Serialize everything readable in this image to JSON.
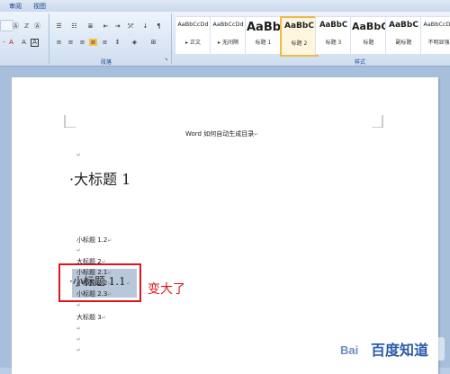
{
  "ribbon": {
    "tabs": [
      "审阅",
      "视图"
    ],
    "group_labels": {
      "paragraph": "段落",
      "styles": "样式"
    },
    "styles": [
      {
        "sample": "AaBbCcDd",
        "name": "▸ 正文"
      },
      {
        "sample": "AaBbCcDd",
        "name": "▸ 无间隔"
      },
      {
        "sample": "AaBb",
        "name": "标题 1"
      },
      {
        "sample": "AaBbC",
        "name": "标题 2"
      },
      {
        "sample": "AaBbC",
        "name": "标题 3"
      },
      {
        "sample": "AaBbC",
        "name": "标题"
      },
      {
        "sample": "AaBbC",
        "name": "副标题"
      },
      {
        "sample": "AaBbCcDd",
        "name": "不明显强"
      }
    ]
  },
  "document": {
    "title": "Word 如何自动生成目录",
    "mark": "↵",
    "h1_a": {
      "text": "大标题 1",
      "bullet": "·"
    },
    "h2_a": {
      "text": "小标题 1.1",
      "bullet": "·"
    },
    "annotation": "变大了",
    "lines": [
      "小标题 1.2",
      "",
      "大标题 2",
      "小标题 2.1",
      "小标题 2.2",
      "小标题 2.3",
      "",
      "大标题 3",
      "",
      "",
      ""
    ]
  },
  "watermark": {
    "text": "百度知道",
    "brand": "Bai"
  }
}
